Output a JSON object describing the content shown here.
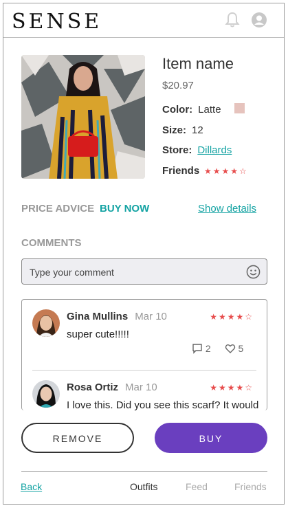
{
  "app": {
    "logo": "SENSE"
  },
  "icons": {
    "bell": "bell-icon",
    "user": "user-icon",
    "emoji": "smiley-icon",
    "comment": "comment-icon",
    "heart": "heart-icon"
  },
  "colors": {
    "accent": "#14a3a3",
    "primary": "#6a3fbf",
    "star": "#e74c4c",
    "swatch": "#e6c3bd"
  },
  "item": {
    "name": "Item name",
    "price": "$20.97",
    "color_label": "Color:",
    "color_value": "Latte",
    "size_label": "Size:",
    "size_value": "12",
    "store_label": "Store:",
    "store_value": "Dillards",
    "friends_label": "Friends",
    "friends_rating": 4,
    "friends_stars": "★★★★☆"
  },
  "advice": {
    "price_advice": "PRICE ADVICE",
    "buy_now": "BUY NOW",
    "show_details": "Show details"
  },
  "comments": {
    "label": "COMMENTS",
    "input_placeholder": "Type your comment",
    "items": [
      {
        "name": "Gina Mullins",
        "date": "Mar 10",
        "text": "super cute!!!!!",
        "rating": 4,
        "stars": "★★★★☆",
        "comment_count": "2",
        "like_count": "5"
      },
      {
        "name": "Rosa Ortiz",
        "date": "Mar 10",
        "text": "I love this. Did you see this scarf? It would go great with that.",
        "rating": 4,
        "stars": "★★★★☆"
      }
    ]
  },
  "actions": {
    "remove": "REMOVE",
    "buy": "BUY"
  },
  "nav": {
    "back": "Back",
    "outfits": "Outfits",
    "feed": "Feed",
    "friends": "Friends"
  }
}
